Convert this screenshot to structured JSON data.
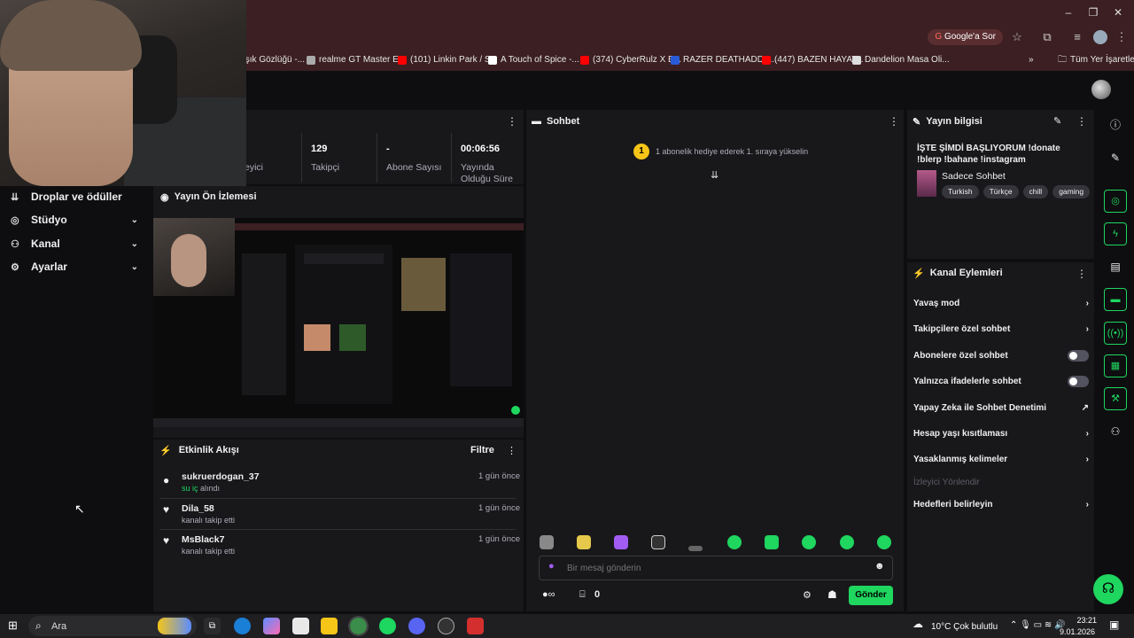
{
  "browser": {
    "google_chip": "Google'a Sor",
    "bookmarks": [
      {
        "label": "Işık Gözlüğü -...",
        "color": "#777777"
      },
      {
        "label": "realme GT Master E...",
        "color": "#aaaaaa"
      },
      {
        "label": "(101) Linkin Park / S...",
        "color": "#ff0000"
      },
      {
        "label": "A Touch of Spice -...",
        "color": "#ffffff"
      },
      {
        "label": "(374) CyberRulz X B...",
        "color": "#ff0000"
      },
      {
        "label": "RAZER DEATHADDE...",
        "color": "#2a5bd7"
      },
      {
        "label": "(447) BAZEN HAYAT...",
        "color": "#ff0000"
      },
      {
        "label": "Dandelion Masa Oli...",
        "color": "#dddddd"
      }
    ],
    "all_bookmarks": "Tüm Yer İşaretleri",
    "more": "»"
  },
  "stats": {
    "viewers_label": "eyici",
    "followers_value": "129",
    "followers_label": "Takipçi",
    "subs_value": "-",
    "subs_label": "Abone Sayısı",
    "uptime_value": "00:06:56",
    "uptime_label": "Yayında Olduğu Süre"
  },
  "leftnav": {
    "items": [
      {
        "label": "Droplar ve ödüller",
        "icon": "drops-icon"
      },
      {
        "label": "Stüdyo",
        "icon": "studio-icon"
      },
      {
        "label": "Kanal",
        "icon": "channel-icon"
      },
      {
        "label": "Ayarlar",
        "icon": "gear-icon"
      }
    ]
  },
  "preview": {
    "title": "Yayın Ön İzlemesi"
  },
  "activity": {
    "title": "Etkinlik Akışı",
    "filter": "Filtre",
    "events": [
      {
        "name": "sukruerdogan_37",
        "detail_prefix": "su iç",
        "detail_suffix": " alındı",
        "time": "1 gün önce",
        "icon": "points-icon"
      },
      {
        "name": "Dila_58",
        "detail_prefix": "",
        "detail_suffix": "kanalı takip etti",
        "time": "1 gün önce",
        "icon": "heart-icon"
      },
      {
        "name": "MsBlack7",
        "detail_prefix": "",
        "detail_suffix": "kanalı takip etti",
        "time": "1 gün önce",
        "icon": "heart-icon"
      }
    ]
  },
  "chat": {
    "title": "Sohbet",
    "gift_badge": "1",
    "gift_text": "1 abonelik hediye ederek 1. sıraya yükselin",
    "placeholder": "Bir mesaj gönderin",
    "points": "0",
    "send": "Gönder"
  },
  "info": {
    "title": "Yayın bilgisi",
    "stream_title": "İŞTE ŞİMDİ BAŞLIYORUM !donate !blerp !bahane !instagram",
    "category": "Sadece Sohbet",
    "tags": [
      "Turkish",
      "Türkçe",
      "chill",
      "gaming"
    ]
  },
  "actions": {
    "title": "Kanal Eylemleri",
    "rows": [
      {
        "label": "Yavaş mod",
        "control": "chevron"
      },
      {
        "label": "Takipçilere özel sohbet",
        "control": "chevron"
      },
      {
        "label": "Abonelere özel sohbet",
        "control": "toggle"
      },
      {
        "label": "Yalnızca ifadelerle sohbet",
        "control": "toggle"
      },
      {
        "label": "Yapay Zeka ile Sohbet Denetimi",
        "control": "external"
      },
      {
        "label": "Hesap yaşı kısıtlaması",
        "control": "chevron"
      },
      {
        "label": "Yasaklanmış kelimeler",
        "control": "chevron"
      },
      {
        "label": "İzleyici Yönlendir",
        "control": "disabled"
      },
      {
        "label": "Hedefleri belirleyin",
        "control": "chevron"
      }
    ]
  },
  "taskbar": {
    "search": "Ara",
    "weather": "10°C  Çok bulutlu",
    "time": "23:21",
    "date": "9.01.2026"
  },
  "colors": {
    "accent": "#1fd65f",
    "panel": "#18181b",
    "bg": "#0e0e10",
    "chrome": "#3b1f22"
  }
}
